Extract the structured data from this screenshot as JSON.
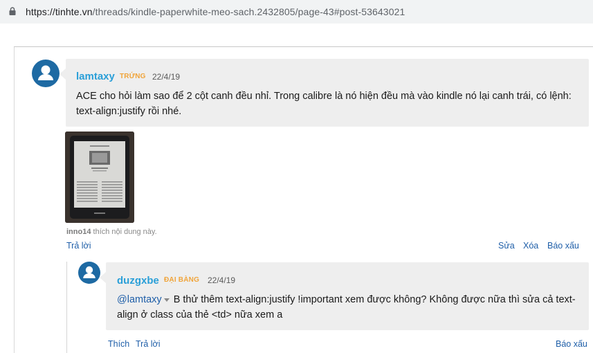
{
  "browser": {
    "url_host": "https://tinhte.vn",
    "url_path": "/threads/kindle-paperwhite-meo-sach.2432805/page-43#post-53643021"
  },
  "post1": {
    "username": "lamtaxy",
    "rank": "TRỨNG",
    "date": "22/4/19",
    "message": "ACE cho hỏi làm sao để 2 cột canh đều nhỉ. Trong calibre là nó hiện đều mà vào kindle nó lại canh trái, có lệnh: text-align:justify rồi nhé.",
    "attachment_icon": "kindle-photo",
    "likes_user": "inno14",
    "likes_text": "thích nội dung này.",
    "actions": {
      "reply": "Trả lời",
      "edit": "Sửa",
      "delete": "Xóa",
      "report": "Báo xấu"
    }
  },
  "post2": {
    "username": "duzgxbe",
    "rank": "ĐẠI BÀNG",
    "date": "22/4/19",
    "mention": "@lamtaxy",
    "message": "B thử thêm text-align:justify !important xem được không? Không được nữa thì sửa cả text-align ở class của thẻ <td> nữa xem a",
    "actions": {
      "like": "Thích",
      "reply": "Trả lời",
      "report": "Báo xấu"
    }
  },
  "colors": {
    "username": "#2a9fd8",
    "rank": "#f0a43a",
    "link": "#1e5ea8",
    "avatar": "#1e6aa3",
    "bubble": "#eeeeee"
  }
}
